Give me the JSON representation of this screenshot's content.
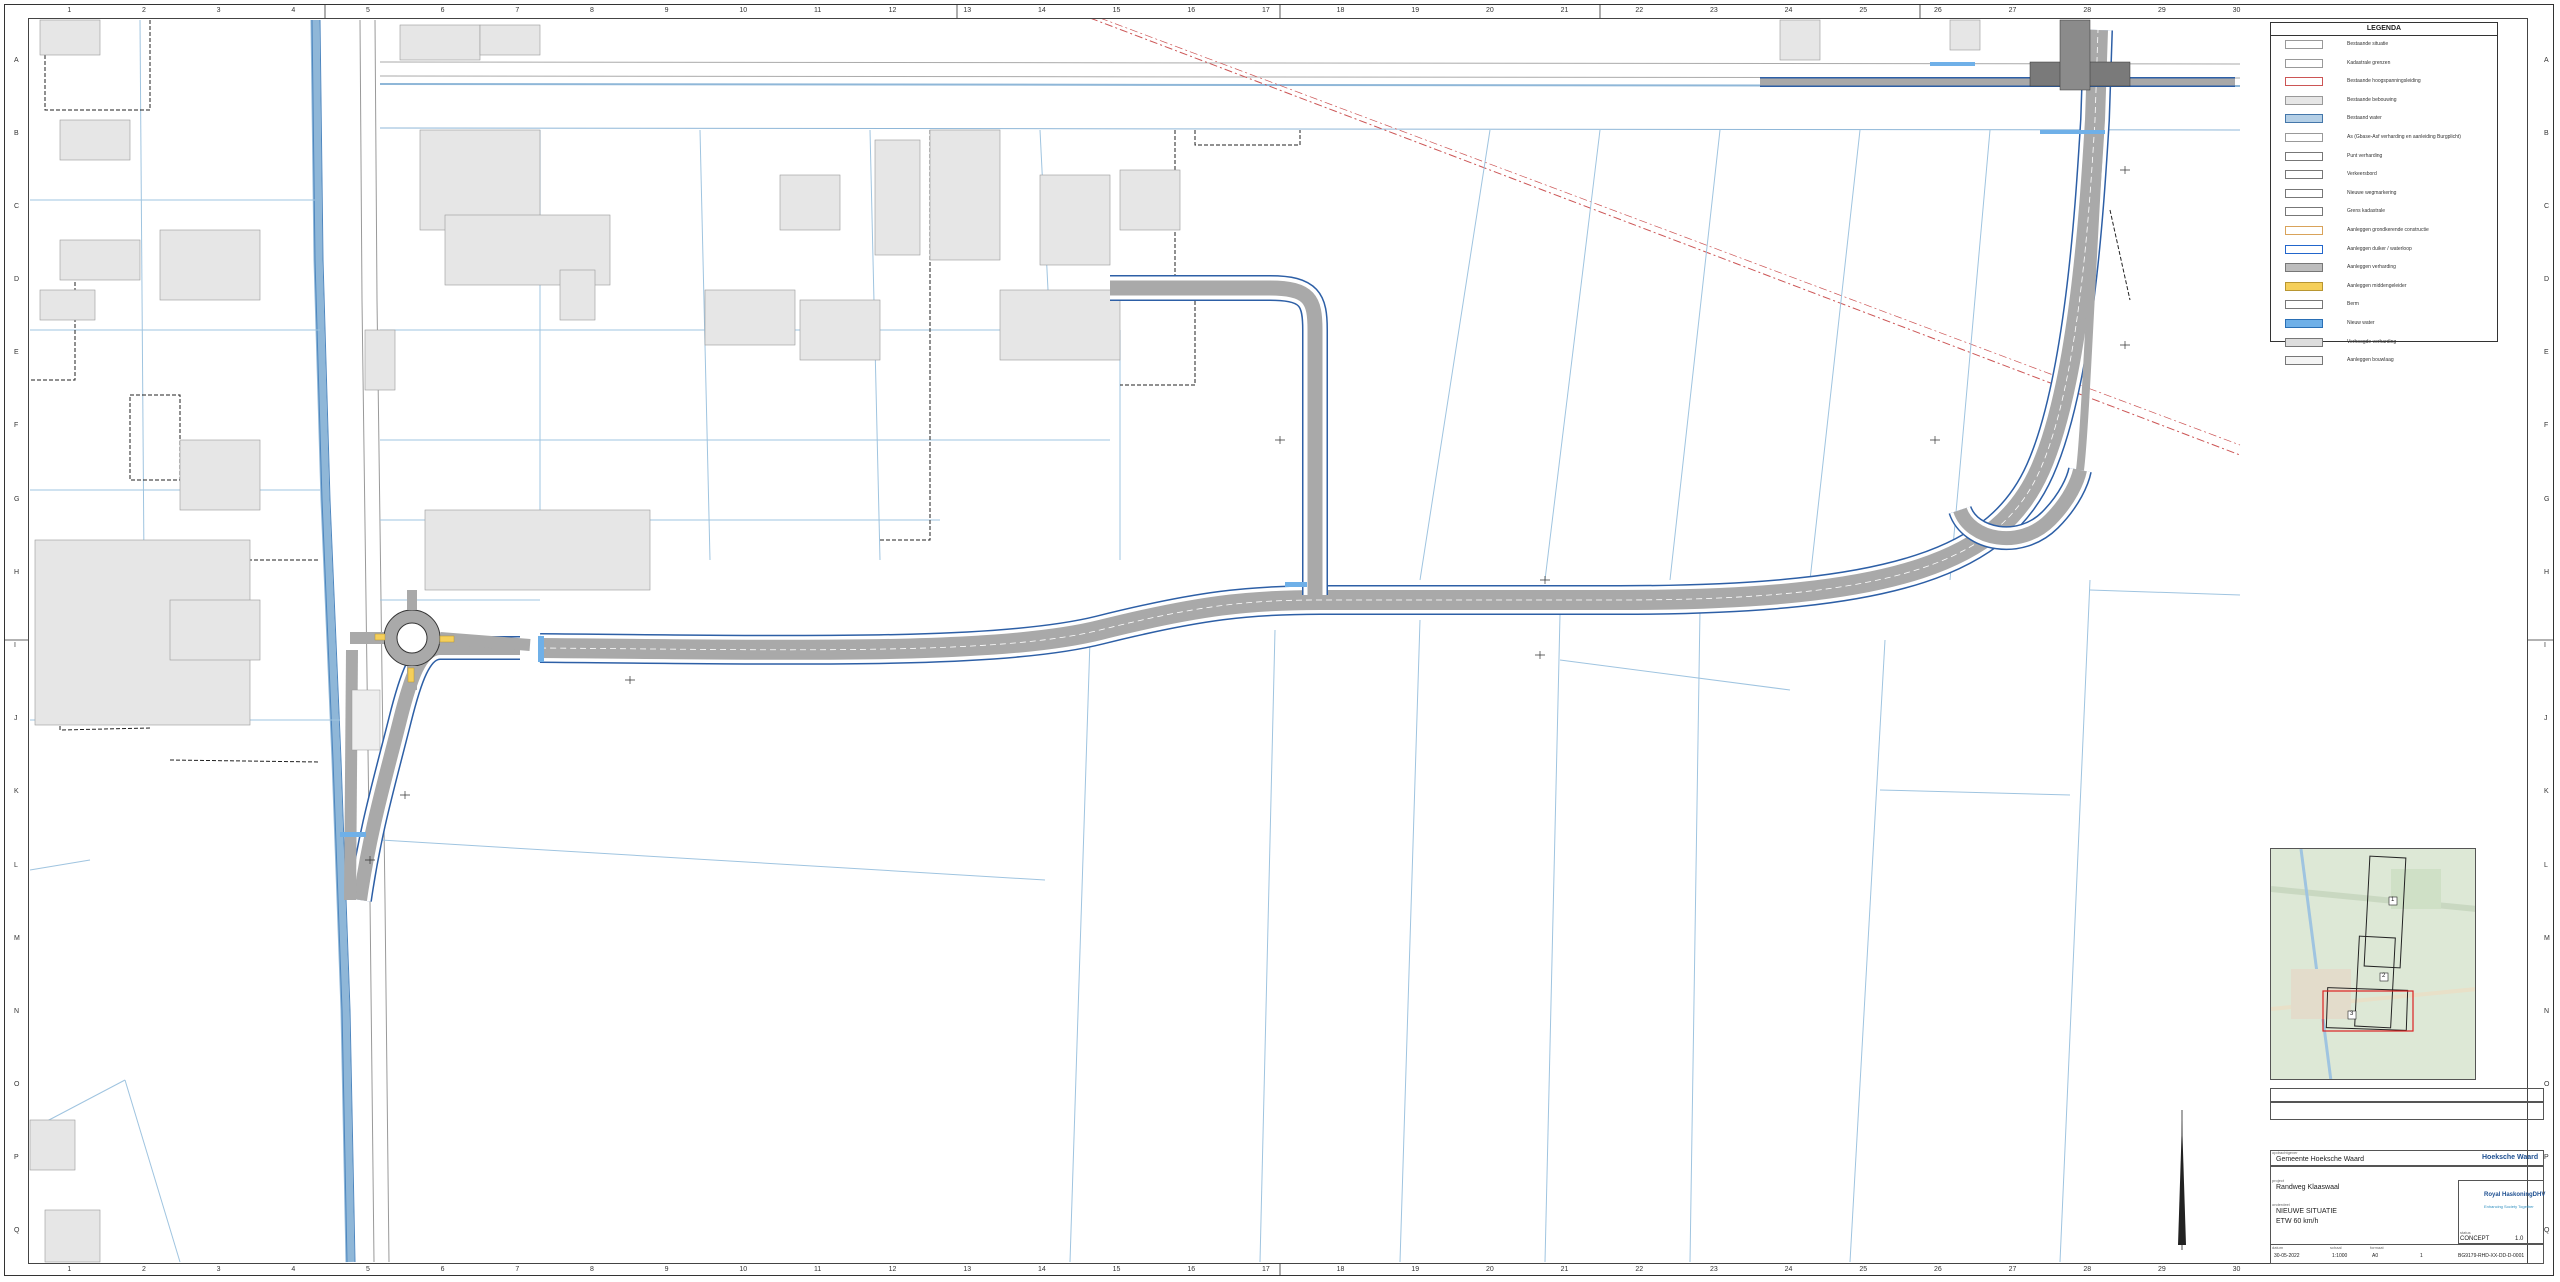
{
  "legend": {
    "title": "LEGENDA",
    "items": [
      {
        "label": "Bestaande situatie",
        "swatch": "#ffffff",
        "border": "#999999"
      },
      {
        "label": "Kadastrale grenzen",
        "swatch": "#ffffff",
        "border": "#999999"
      },
      {
        "label": "Bestaande hoogspanningsleiding",
        "swatch": "#ffffff",
        "border": "#cc5555"
      },
      {
        "label": "Bestaande bebouwing",
        "swatch": "#e6e6e6",
        "border": "#999999"
      },
      {
        "label": "Bestaand water",
        "swatch": "#b4cfe6",
        "border": "#4477aa"
      },
      {
        "label": "As (Gbase-Asf verharding en aanleiding Burgplicht)",
        "swatch": "#ffffff",
        "border": "#999999"
      },
      {
        "label": "Punt verharding",
        "swatch": "#ffffff",
        "border": "#777777"
      },
      {
        "label": "Verkeersbord",
        "swatch": "#ffffff",
        "border": "#777777"
      },
      {
        "label": "Nieuwe wegmarkering",
        "swatch": "#ffffff",
        "border": "#777777"
      },
      {
        "label": "Grens kadastrale",
        "swatch": "#ffffff",
        "border": "#777777"
      },
      {
        "label": "Aanleggen grondkerende constructie",
        "swatch": "#ffffff",
        "border": "#d9a35a"
      },
      {
        "label": "Aanleggen duiker / waterloop",
        "swatch": "#ffffff",
        "border": "#2266cc"
      },
      {
        "label": "Aanleggen verharding",
        "swatch": "#bdbdbd",
        "border": "#777777"
      },
      {
        "label": "Aanleggen middengeleider",
        "swatch": "#f5cf5a",
        "border": "#b89632"
      },
      {
        "label": "Berm",
        "swatch": "#ffffff",
        "border": "#777777"
      },
      {
        "label": "Nieuw water",
        "swatch": "#6fb0e8",
        "border": "#2a6fb5"
      },
      {
        "label": "Verhoogde verharding",
        "swatch": "#dddddd",
        "border": "#777777"
      },
      {
        "label": "Aanleggen bouwlaag",
        "swatch": "#f4f4f4",
        "border": "#777777"
      }
    ]
  },
  "titleblock": {
    "client_label": "opdrachtgever",
    "client": "Gemeente Hoeksche Waard",
    "project_label": "project",
    "project": "Randweg Klaaswaal",
    "drawing_label": "onderdeel",
    "drawing_title": "NIEUWE SITUATIE",
    "drawing_subtitle": "ETW 60 km/h",
    "status_label": "status",
    "status": "CONCEPT",
    "company": "Royal HaskoningDHV",
    "company_tagline": "Enhancing Society Together",
    "client_brand": "Hoeksche Waard",
    "scale_label": "schaal",
    "scale": "1:1000",
    "format_label": "formaat",
    "format": "A0",
    "sheet": "1",
    "drawing_number": "BG9179-RHD-XX-DD-D-0001",
    "revision": "1.0",
    "date_label": "datum",
    "date": "30-05-2022"
  },
  "grid": {
    "columns": [
      "1",
      "2",
      "3",
      "4",
      "5",
      "6",
      "7",
      "8",
      "9",
      "10",
      "11",
      "12",
      "13",
      "14",
      "15",
      "16",
      "17",
      "18",
      "19",
      "20",
      "21",
      "22",
      "23",
      "24",
      "25",
      "26",
      "27",
      "28",
      "29",
      "30"
    ],
    "rows": [
      "A",
      "B",
      "C",
      "D",
      "E",
      "F",
      "G",
      "H",
      "I",
      "J",
      "K",
      "L",
      "M",
      "N",
      "O",
      "P",
      "Q"
    ]
  },
  "keymap": {
    "sheet_labels": [
      "1",
      "2",
      "3"
    ],
    "colors": {
      "map": "#dde8d6",
      "sheet": "#222222",
      "current": "#dd2222"
    }
  },
  "colors": {
    "road": "#9d9d9d",
    "road_edge": "#2d5fa6",
    "water": "#6fb0e8",
    "building": "#e6e6e6",
    "parcel": "#8fb7d8",
    "cadastral": "#222222",
    "powerline": "#cc5555"
  }
}
